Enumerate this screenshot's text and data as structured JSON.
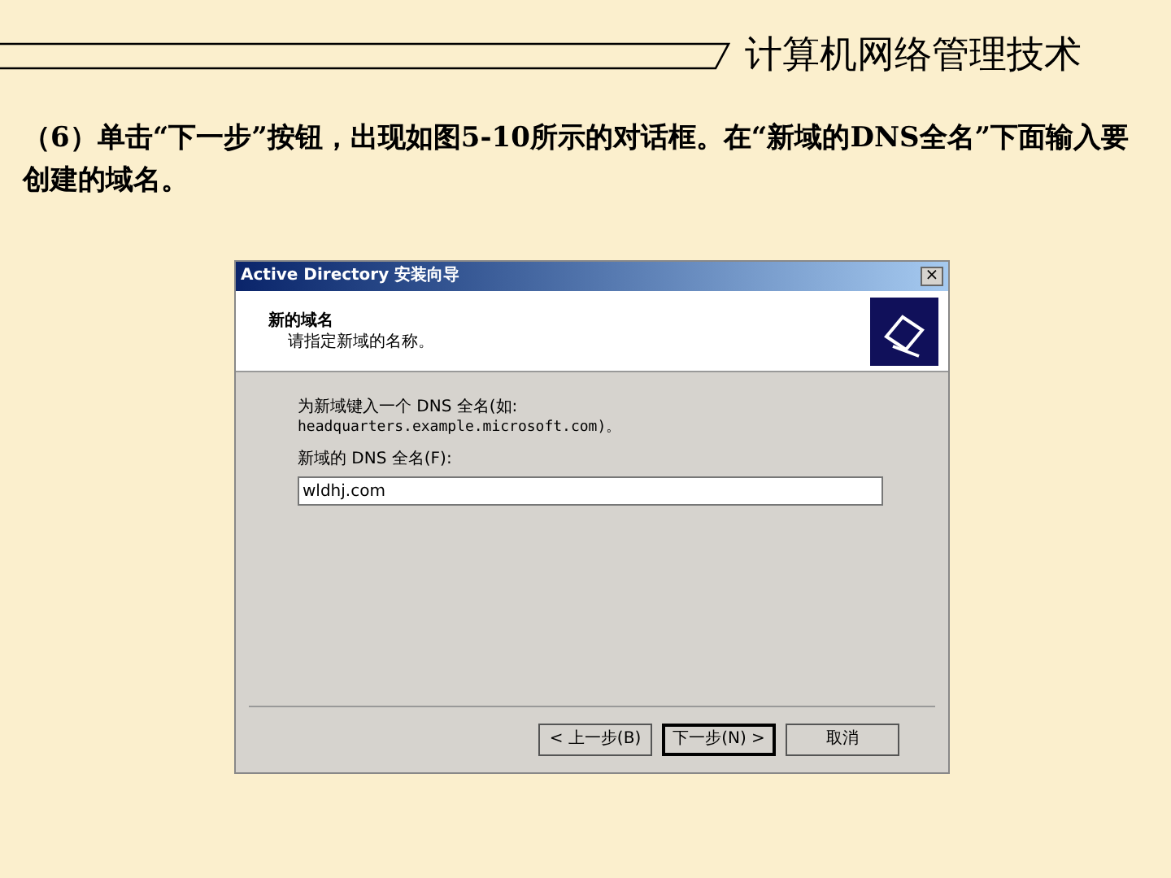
{
  "slide": {
    "header_title": "计算机网络管理技术",
    "paragraph": "（6）单击“下一步”按钮，出现如图5-10所示的对话框。在“新域的DNS全名”下面输入要创建的域名。"
  },
  "dialog": {
    "title": "Active Directory 安装向导",
    "close": "×",
    "heading": "新的域名",
    "subheading": "请指定新域的名称。",
    "instruction": "为新域键入一个 DNS 全名(如:",
    "example": "headquarters.example.microsoft.com)。",
    "field_label": "新域的 DNS 全名(F):",
    "field_value": "wldhj.com",
    "buttons": [
      {
        "label": "< 上一步(B)",
        "focused": false
      },
      {
        "label": "下一步(N) >",
        "focused": true
      },
      {
        "label": "取消",
        "focused": false
      }
    ]
  }
}
